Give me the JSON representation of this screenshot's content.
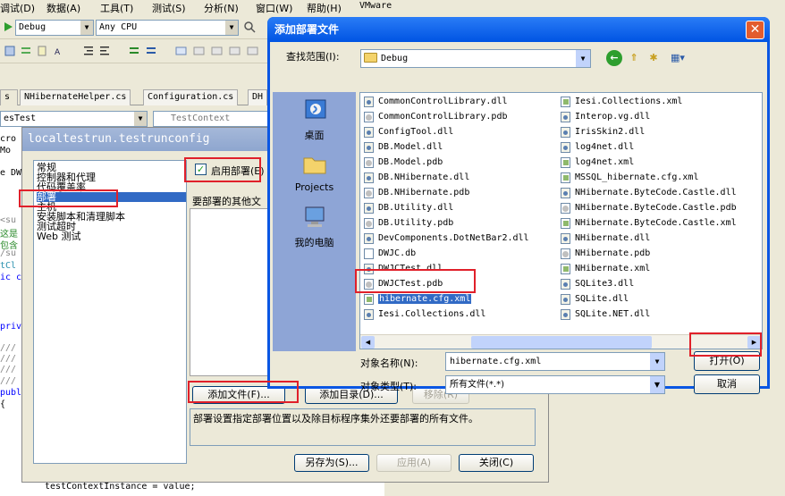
{
  "menu": [
    "调试(D)",
    "数据(A)",
    "工具(T)",
    "测试(S)",
    "分析(N)",
    "窗口(W)",
    "帮助(H)",
    "VMware"
  ],
  "toolbar": {
    "config_combo": "Debug",
    "platform_combo": "Any CPU"
  },
  "ide": {
    "tabs": [
      "NHibernateHelper.cs",
      "Configuration.cs",
      "DH"
    ],
    "class_combo": "esTest",
    "member_combo": "TestContext",
    "code_fragments": [
      "cro",
      "Mo",
      "e DW",
      "<su",
      "这是",
      "包含",
      "/su",
      "tCl",
      "ic c",
      "priv",
      "///",
      "///",
      "///",
      "///",
      "publ",
      "{"
    ],
    "bottom_line": "testContextInstance = value;"
  },
  "config_dialog": {
    "title": "localtestrun.testrunconfig",
    "nav_items": [
      "常规",
      "控制器和代理",
      "代码覆盖率",
      "部署",
      "主机",
      "安装脚本和清理脚本",
      "测试超时",
      "Web 测试"
    ],
    "selected_nav": "部署",
    "enable_label": "启用部署(E)",
    "other_files_label": "要部署的其他文",
    "add_file_button": "添加文件(F)...",
    "add_dir_button": "添加目录(D)...",
    "remove_button": "移除(R)",
    "description": "部署设置指定部署位置以及除目标程序集外还要部署的所有文件。",
    "save_as_button": "另存为(S)...",
    "apply_button": "应用(A)",
    "close_button": "关闭(C)"
  },
  "open_dialog": {
    "title": "添加部署文件",
    "look_in_label": "查找范围(I):",
    "look_in_value": "Debug",
    "places": [
      "桌面",
      "Projects",
      "我的电脑"
    ],
    "files_left": [
      {
        "name": "CommonControlLibrary.dll",
        "type": "dll"
      },
      {
        "name": "CommonControlLibrary.pdb",
        "type": "pdb"
      },
      {
        "name": "ConfigTool.dll",
        "type": "dll"
      },
      {
        "name": "DB.Model.dll",
        "type": "dll"
      },
      {
        "name": "DB.Model.pdb",
        "type": "pdb"
      },
      {
        "name": "DB.NHibernate.dll",
        "type": "dll"
      },
      {
        "name": "DB.NHibernate.pdb",
        "type": "pdb"
      },
      {
        "name": "DB.Utility.dll",
        "type": "dll"
      },
      {
        "name": "DB.Utility.pdb",
        "type": "pdb"
      },
      {
        "name": "DevComponents.DotNetBar2.dll",
        "type": "dll"
      },
      {
        "name": "DWJC.db",
        "type": "db"
      },
      {
        "name": "DWJCTest.dll",
        "type": "dll"
      },
      {
        "name": "DWJCTest.pdb",
        "type": "pdb"
      },
      {
        "name": "hibernate.cfg.xml",
        "type": "xml"
      },
      {
        "name": "Iesi.Collections.dll",
        "type": "dll"
      }
    ],
    "files_right": [
      {
        "name": "Iesi.Collections.xml",
        "type": "xml"
      },
      {
        "name": "Interop.vg.dll",
        "type": "dll"
      },
      {
        "name": "IrisSkin2.dll",
        "type": "dll"
      },
      {
        "name": "log4net.dll",
        "type": "dll"
      },
      {
        "name": "log4net.xml",
        "type": "xml"
      },
      {
        "name": "MSSQL_hibernate.cfg.xml",
        "type": "xml"
      },
      {
        "name": "NHibernate.ByteCode.Castle.dll",
        "type": "dll"
      },
      {
        "name": "NHibernate.ByteCode.Castle.pdb",
        "type": "pdb"
      },
      {
        "name": "NHibernate.ByteCode.Castle.xml",
        "type": "xml"
      },
      {
        "name": "NHibernate.dll",
        "type": "dll"
      },
      {
        "name": "NHibernate.pdb",
        "type": "pdb"
      },
      {
        "name": "NHibernate.xml",
        "type": "xml"
      },
      {
        "name": "SQLite3.dll",
        "type": "dll"
      },
      {
        "name": "SQLite.dll",
        "type": "dll"
      },
      {
        "name": "SQLite.NET.dll",
        "type": "dll"
      }
    ],
    "selected_file": "hibernate.cfg.xml",
    "filename_label": "对象名称(N):",
    "filename_value": "hibernate.cfg.xml",
    "filetype_label": "对象类型(T):",
    "filetype_value": "所有文件(*.*)",
    "open_button": "打开(O)",
    "cancel_button": "取消"
  }
}
